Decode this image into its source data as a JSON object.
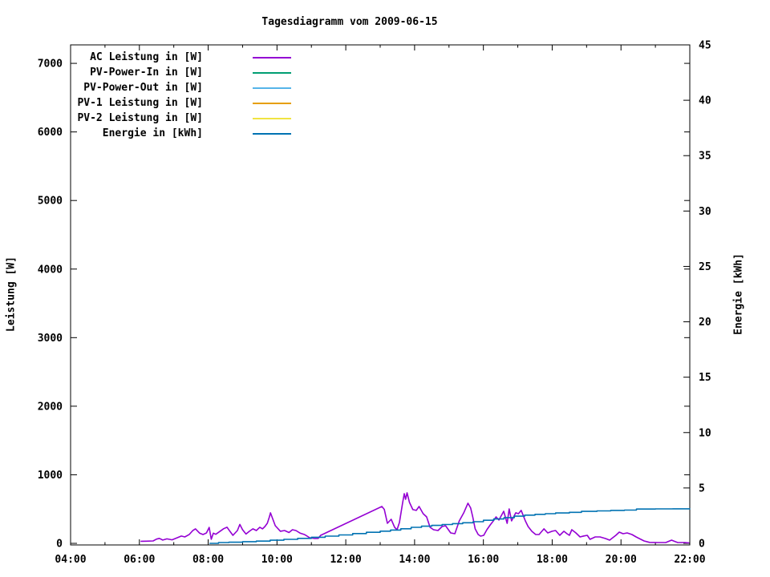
{
  "title": "Tagesdiagramm vom 2009-06-15",
  "axes": {
    "x": {
      "range_hours": [
        4,
        22
      ],
      "major_tick_labels": [
        "04:00",
        "06:00",
        "08:00",
        "10:00",
        "12:00",
        "14:00",
        "16:00",
        "18:00",
        "20:00",
        "22:00"
      ],
      "minor_tick_every_hours": 1
    },
    "y_left": {
      "title": "Leistung [W]",
      "tick_labels": [
        "0",
        "1000",
        "2000",
        "3000",
        "4000",
        "5000",
        "6000",
        "7000"
      ],
      "tick_values": [
        0,
        1000,
        2000,
        3000,
        4000,
        5000,
        6000,
        7000
      ]
    },
    "y_right": {
      "title": "Energie [kWh]",
      "tick_labels": [
        "0",
        "5",
        "10",
        "15",
        "20",
        "25",
        "30",
        "35",
        "40",
        "45"
      ],
      "tick_values": [
        0,
        5,
        10,
        15,
        20,
        25,
        30,
        35,
        40,
        45
      ]
    }
  },
  "legend": [
    {
      "label": "AC Leistung in [W]",
      "color": "#9400d3"
    },
    {
      "label": "PV-Power-In in [W]",
      "color": "#009e73"
    },
    {
      "label": "PV-Power-Out in [W]",
      "color": "#56b4e9"
    },
    {
      "label": "PV-1 Leistung in [W]",
      "color": "#e69f00"
    },
    {
      "label": "PV-2 Leistung in [W]",
      "color": "#f0e442"
    },
    {
      "label": "Energie in [kWh]",
      "color": "#0072b2"
    }
  ],
  "chart_data": {
    "type": "line",
    "title": "Tagesdiagramm vom 2009-06-15",
    "xlabel": "",
    "x_unit": "hour_of_day",
    "x_range": [
      4,
      22
    ],
    "ylabel_left": "Leistung [W]",
    "ylabel_right": "Energie [kWh]",
    "ylim_left": [
      0,
      7270
    ],
    "ylim_right": [
      0,
      45
    ],
    "grid": false,
    "legend_position": "top-left-inside",
    "series": [
      {
        "name": "AC Leistung in [W]",
        "axis": "left",
        "color": "#9400d3",
        "style": "line",
        "points": [
          [
            6.05,
            30
          ],
          [
            6.2,
            32
          ],
          [
            6.4,
            35
          ],
          [
            6.5,
            62
          ],
          [
            6.58,
            72
          ],
          [
            6.68,
            48
          ],
          [
            6.8,
            66
          ],
          [
            6.95,
            52
          ],
          [
            7.1,
            82
          ],
          [
            7.22,
            106
          ],
          [
            7.32,
            94
          ],
          [
            7.45,
            130
          ],
          [
            7.55,
            186
          ],
          [
            7.63,
            211
          ],
          [
            7.75,
            150
          ],
          [
            7.85,
            128
          ],
          [
            7.95,
            152
          ],
          [
            8.03,
            232
          ],
          [
            8.09,
            60
          ],
          [
            8.15,
            148
          ],
          [
            8.22,
            132
          ],
          [
            8.32,
            167
          ],
          [
            8.45,
            214
          ],
          [
            8.55,
            235
          ],
          [
            8.63,
            176
          ],
          [
            8.72,
            117
          ],
          [
            8.85,
            187
          ],
          [
            8.92,
            276
          ],
          [
            9.0,
            199
          ],
          [
            9.1,
            135
          ],
          [
            9.2,
            176
          ],
          [
            9.3,
            211
          ],
          [
            9.4,
            187
          ],
          [
            9.5,
            235
          ],
          [
            9.58,
            211
          ],
          [
            9.65,
            246
          ],
          [
            9.72,
            293
          ],
          [
            9.78,
            387
          ],
          [
            9.81,
            445
          ],
          [
            9.87,
            363
          ],
          [
            9.95,
            257
          ],
          [
            10.1,
            176
          ],
          [
            10.22,
            187
          ],
          [
            10.35,
            158
          ],
          [
            10.45,
            199
          ],
          [
            10.55,
            187
          ],
          [
            10.68,
            147
          ],
          [
            10.8,
            129
          ],
          [
            10.95,
            82
          ],
          [
            11.1,
            70
          ],
          [
            11.2,
            73
          ],
          [
            11.27,
            117
          ],
          [
            13.05,
            538
          ],
          [
            13.12,
            495
          ],
          [
            13.21,
            292
          ],
          [
            13.32,
            351
          ],
          [
            13.42,
            234
          ],
          [
            13.49,
            199
          ],
          [
            13.56,
            304
          ],
          [
            13.65,
            585
          ],
          [
            13.7,
            725
          ],
          [
            13.74,
            643
          ],
          [
            13.78,
            737
          ],
          [
            13.85,
            597
          ],
          [
            13.95,
            492
          ],
          [
            14.05,
            480
          ],
          [
            14.13,
            538
          ],
          [
            14.25,
            433
          ],
          [
            14.35,
            386
          ],
          [
            14.45,
            234
          ],
          [
            14.55,
            199
          ],
          [
            14.68,
            187
          ],
          [
            14.8,
            246
          ],
          [
            14.9,
            257
          ],
          [
            15.05,
            152
          ],
          [
            15.17,
            140
          ],
          [
            15.3,
            327
          ],
          [
            15.43,
            445
          ],
          [
            15.55,
            585
          ],
          [
            15.63,
            515
          ],
          [
            15.69,
            386
          ],
          [
            15.76,
            211
          ],
          [
            15.85,
            129
          ],
          [
            15.92,
            105
          ],
          [
            16.01,
            117
          ],
          [
            16.1,
            199
          ],
          [
            16.2,
            269
          ],
          [
            16.29,
            327
          ],
          [
            16.37,
            386
          ],
          [
            16.45,
            340
          ],
          [
            16.59,
            468
          ],
          [
            16.69,
            292
          ],
          [
            16.75,
            503
          ],
          [
            16.82,
            327
          ],
          [
            16.94,
            445
          ],
          [
            17.02,
            433
          ],
          [
            17.1,
            480
          ],
          [
            17.22,
            327
          ],
          [
            17.3,
            245
          ],
          [
            17.41,
            175
          ],
          [
            17.52,
            129
          ],
          [
            17.62,
            129
          ],
          [
            17.76,
            211
          ],
          [
            17.87,
            152
          ],
          [
            18.0,
            176
          ],
          [
            18.1,
            187
          ],
          [
            18.22,
            117
          ],
          [
            18.34,
            176
          ],
          [
            18.43,
            140
          ],
          [
            18.5,
            117
          ],
          [
            18.57,
            199
          ],
          [
            18.69,
            152
          ],
          [
            18.81,
            94
          ],
          [
            18.92,
            108
          ],
          [
            19.02,
            117
          ],
          [
            19.1,
            59
          ],
          [
            19.25,
            94
          ],
          [
            19.39,
            94
          ],
          [
            19.55,
            70
          ],
          [
            19.67,
            47
          ],
          [
            19.85,
            117
          ],
          [
            19.95,
            164
          ],
          [
            20.06,
            140
          ],
          [
            20.18,
            152
          ],
          [
            20.32,
            129
          ],
          [
            20.44,
            94
          ],
          [
            20.53,
            70
          ],
          [
            20.67,
            35
          ],
          [
            20.83,
            14
          ],
          [
            21.07,
            12
          ],
          [
            21.3,
            12
          ],
          [
            21.47,
            47
          ],
          [
            21.57,
            26
          ],
          [
            21.65,
            12
          ],
          [
            21.85,
            12
          ],
          [
            21.97,
            7
          ]
        ]
      },
      {
        "name": "PV-Power-In in [W]",
        "axis": "left",
        "color": "#009e73",
        "style": "line",
        "points": []
      },
      {
        "name": "PV-Power-Out in [W]",
        "axis": "left",
        "color": "#56b4e9",
        "style": "line",
        "points": []
      },
      {
        "name": "PV-1 Leistung in [W]",
        "axis": "left",
        "color": "#e69f00",
        "style": "line",
        "points": []
      },
      {
        "name": "PV-2 Leistung in [W]",
        "axis": "left",
        "color": "#f0e442",
        "style": "line",
        "points": []
      },
      {
        "name": "Energie in [kWh]",
        "axis": "right",
        "color": "#0072b2",
        "style": "steps",
        "points": [
          [
            8.05,
            0.0
          ],
          [
            8.3,
            0.07
          ],
          [
            8.6,
            0.1
          ],
          [
            9.0,
            0.15
          ],
          [
            9.4,
            0.2
          ],
          [
            9.8,
            0.28
          ],
          [
            10.2,
            0.36
          ],
          [
            10.6,
            0.45
          ],
          [
            11.0,
            0.55
          ],
          [
            11.4,
            0.65
          ],
          [
            11.8,
            0.76
          ],
          [
            12.2,
            0.88
          ],
          [
            12.6,
            1.0
          ],
          [
            13.0,
            1.1
          ],
          [
            13.3,
            1.2
          ],
          [
            13.6,
            1.32
          ],
          [
            13.9,
            1.45
          ],
          [
            14.2,
            1.55
          ],
          [
            14.5,
            1.62
          ],
          [
            14.8,
            1.7
          ],
          [
            15.1,
            1.78
          ],
          [
            15.4,
            1.86
          ],
          [
            15.7,
            1.95
          ],
          [
            16.0,
            2.08
          ],
          [
            16.3,
            2.2
          ],
          [
            16.6,
            2.32
          ],
          [
            16.9,
            2.45
          ],
          [
            17.2,
            2.55
          ],
          [
            17.5,
            2.62
          ],
          [
            17.8,
            2.68
          ],
          [
            18.1,
            2.74
          ],
          [
            18.5,
            2.8
          ],
          [
            18.85,
            2.89
          ],
          [
            19.3,
            2.93
          ],
          [
            19.7,
            2.97
          ],
          [
            20.1,
            3.0
          ],
          [
            20.45,
            3.1
          ],
          [
            21.0,
            3.11
          ],
          [
            21.5,
            3.12
          ],
          [
            22.0,
            3.12
          ]
        ]
      }
    ]
  }
}
